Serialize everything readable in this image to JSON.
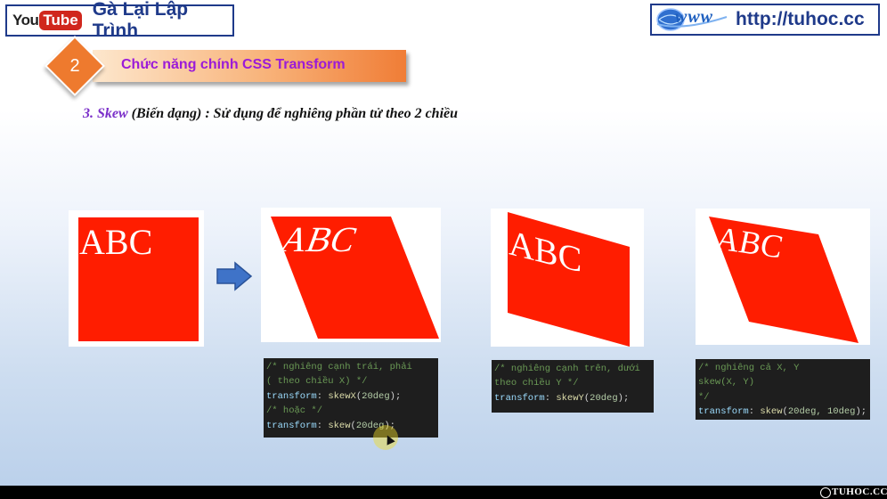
{
  "header": {
    "youtube": {
      "you": "You",
      "tube": "Tube"
    },
    "channel_name": "Gà Lại Lập Trình",
    "www_text": "www",
    "site_url": "http://tuhoc.cc"
  },
  "section": {
    "number": "2",
    "title": "Chức năng chính CSS Transform"
  },
  "subtitle": {
    "keyword": "3. Skew",
    "rest": " (Biến dạng) : Sử dụng để nghiêng phần tử theo 2 chiều"
  },
  "demos": [
    {
      "text": "ABC",
      "transform": "none"
    },
    {
      "text": "ABC",
      "transform": "skewX(20deg)"
    },
    {
      "text": "ABC",
      "transform": "skewY(20deg)"
    },
    {
      "text": "ABC",
      "transform": "skew(20deg, 10deg)"
    }
  ],
  "code": {
    "skewx": {
      "comment1": "/* nghiêng cạnh trái, phải",
      "comment2": "( theo chiều X) */",
      "prop": "transform",
      "fn": "skewX",
      "arg": "20deg",
      "comment3": "/* hoặc */",
      "prop2": "transform",
      "fn2": "skew",
      "arg2": "20deg"
    },
    "skewy": {
      "comment1": "/* nghiêng cạnh trên, dưới",
      "comment2": "theo chiều Y */",
      "prop": "transform",
      "fn": "skewY",
      "arg": "20deg"
    },
    "skewxy": {
      "comment1": "/* nghiêng cả X, Y",
      "comment2": "skew(X, Y)",
      "comment3": "*/",
      "prop": "transform",
      "fn": "skew",
      "arg": "20deg, 10deg"
    }
  },
  "watermark": "TUHOC.CC",
  "colors": {
    "shape": "#ff1d00",
    "accent_purple": "#9b1bd8",
    "badge_orange": "#ee7a2e",
    "brand_blue": "#1f3a8a"
  }
}
